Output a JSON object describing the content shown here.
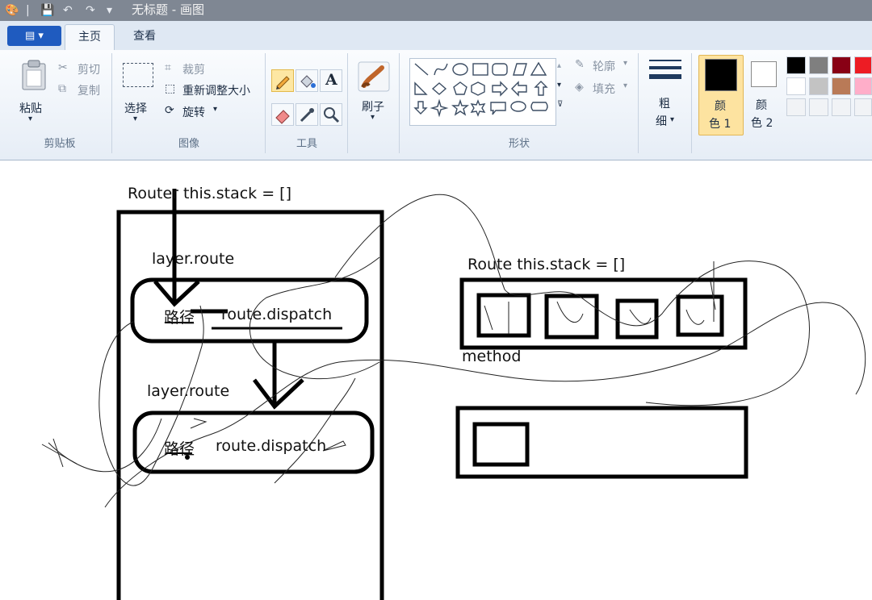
{
  "window": {
    "title": "无标题 - 画图"
  },
  "tabs": {
    "file": "▤ ▾",
    "home": "主页",
    "view": "查看"
  },
  "clipboard": {
    "paste": "粘贴",
    "cut": "剪切",
    "copy": "复制",
    "group": "剪贴板"
  },
  "image": {
    "select": "选择",
    "crop": "裁剪",
    "resize": "重新调整大小",
    "rotate": "旋转",
    "group": "图像"
  },
  "tools": {
    "group": "工具"
  },
  "brushes": {
    "label": "刷子"
  },
  "shapes": {
    "outline": "轮廓",
    "fill": "填充",
    "group": "形状"
  },
  "size": {
    "label_line1": "粗",
    "label_line2": "细"
  },
  "colors": {
    "color1_line1": "颜",
    "color1_line2": "色 1",
    "color2_line1": "颜",
    "color2_line2": "色 2",
    "color1_value": "#000000",
    "color2_value": "#ffffff",
    "palette": [
      "#000000",
      "#7f7f7f",
      "#880015",
      "#ed1c24",
      "#ffffff",
      "#c3c3c3",
      "#b97a57",
      "#ffaec9"
    ]
  },
  "canvas": {
    "router_stack": "Router this.stack = []",
    "layer_route_1": "layer.route",
    "path_1": "路径",
    "dispatch_1": "route.dispatch",
    "layer_route_2": "layer.route",
    "path_2": "路径",
    "dispatch_2": "route.dispatch",
    "route_stack": "Route this.stack = []",
    "method": "method"
  }
}
